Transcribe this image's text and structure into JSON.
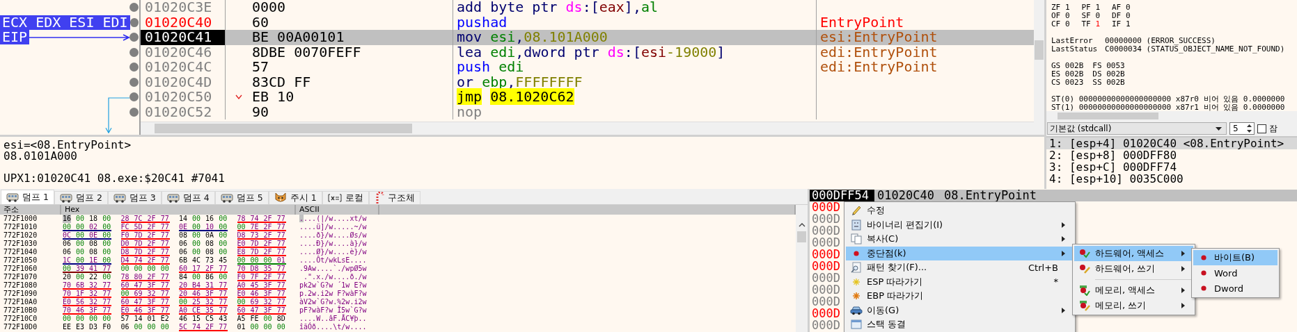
{
  "disasm": {
    "rows": [
      {
        "address": "01020C3E",
        "labeled": false,
        "selected": false,
        "jump": false,
        "bytes": "0000",
        "tokens": [
          {
            "kind": "op",
            "text": "add byte ptr "
          },
          {
            "kind": "seg",
            "text": "ds"
          },
          {
            "kind": "op",
            "text": ":["
          },
          {
            "kind": "mem",
            "text": "eax"
          },
          {
            "kind": "op",
            "text": "],"
          },
          {
            "kind": "reg",
            "text": "al"
          }
        ]
      },
      {
        "address": "01020C40",
        "labeled": true,
        "selected": false,
        "jump": false,
        "tag": {
          "text": "ECX EDX ESI EDI",
          "arrow": false
        },
        "bytes": "60",
        "tokens": [
          {
            "kind": "push",
            "text": "pushad"
          }
        ],
        "comment": {
          "kind": "label",
          "text": "EntryPoint"
        }
      },
      {
        "address": "01020C41",
        "labeled": false,
        "selected": true,
        "jump": false,
        "tag": {
          "text": "EIP",
          "arrow": true
        },
        "bytes": "BE 00A00101",
        "tokens": [
          {
            "kind": "op",
            "text": "mov "
          },
          {
            "kind": "reg",
            "text": "esi"
          },
          {
            "kind": "op",
            "text": ","
          },
          {
            "kind": "num",
            "text": "08.101A000"
          }
        ],
        "comment": {
          "kind": "auto",
          "text": "esi:EntryPoint"
        }
      },
      {
        "address": "01020C46",
        "labeled": false,
        "selected": false,
        "jump": false,
        "bytes": "8DBE 0070FEFF",
        "tokens": [
          {
            "kind": "op",
            "text": "lea "
          },
          {
            "kind": "reg",
            "text": "edi"
          },
          {
            "kind": "op",
            "text": ",dword ptr "
          },
          {
            "kind": "seg",
            "text": "ds"
          },
          {
            "kind": "op",
            "text": ":["
          },
          {
            "kind": "mem",
            "text": "esi"
          },
          {
            "kind": "num",
            "text": "-19000"
          },
          {
            "kind": "op",
            "text": "]"
          }
        ],
        "comment": {
          "kind": "auto",
          "text": "edi:EntryPoint"
        }
      },
      {
        "address": "01020C4C",
        "labeled": false,
        "selected": false,
        "jump": false,
        "bytes": "57",
        "tokens": [
          {
            "kind": "push",
            "text": "push "
          },
          {
            "kind": "reg",
            "text": "edi"
          }
        ],
        "comment": {
          "kind": "auto",
          "text": "edi:EntryPoint"
        }
      },
      {
        "address": "01020C4D",
        "labeled": false,
        "selected": false,
        "jump": false,
        "bytes": "83CD FF",
        "tokens": [
          {
            "kind": "op",
            "text": "or "
          },
          {
            "kind": "reg",
            "text": "ebp"
          },
          {
            "kind": "op",
            "text": ","
          },
          {
            "kind": "num",
            "text": "FFFFFFFF"
          }
        ]
      },
      {
        "address": "01020C50",
        "labeled": false,
        "selected": false,
        "jump": true,
        "bytes": "EB 10",
        "tokens": [
          {
            "kind": "jmp",
            "text": "jmp"
          },
          {
            "kind": "jmp",
            "text": "08.1020C62"
          }
        ]
      },
      {
        "address": "01020C52",
        "labeled": false,
        "selected": false,
        "jump": false,
        "bytes": "90",
        "tokens": [
          {
            "kind": "nop",
            "text": "nop"
          }
        ]
      }
    ]
  },
  "info": {
    "lines": [
      "esi=<08.EntryPoint>",
      "08.0101A000"
    ],
    "location": "UPX1:01020C41 08.exe:$20C41 #7041"
  },
  "registers": {
    "flag_rows": [
      [
        {
          "name": "ZF",
          "value": "1",
          "changed": false
        },
        {
          "name": "PF",
          "value": "1",
          "changed": false
        },
        {
          "name": "AF",
          "value": "0",
          "changed": false
        }
      ],
      [
        {
          "name": "OF",
          "value": "0",
          "changed": false
        },
        {
          "name": "SF",
          "value": "0",
          "changed": false
        },
        {
          "name": "DF",
          "value": "0",
          "changed": false
        }
      ],
      [
        {
          "name": "CF",
          "value": "0",
          "changed": false
        },
        {
          "name": "TF",
          "value": "1",
          "changed": true
        },
        {
          "name": "IF",
          "value": "1",
          "changed": false
        }
      ]
    ],
    "errors": [
      {
        "name": "LastError",
        "value": "00000000 (ERROR_SUCCESS)"
      },
      {
        "name": "LastStatus",
        "value": "C0000034 (STATUS_OBJECT_NAME_NOT_FOUND)"
      }
    ],
    "segment_rows": [
      [
        {
          "name": "GS",
          "value": "002B"
        },
        {
          "name": "FS",
          "value": "0053"
        }
      ],
      [
        {
          "name": "ES",
          "value": "002B"
        },
        {
          "name": "DS",
          "value": "002B"
        }
      ],
      [
        {
          "name": "CS",
          "value": "0023"
        },
        {
          "name": "SS",
          "value": "002B"
        }
      ]
    ],
    "fpu": [
      "ST(0) 00000000000000000000 x87r0 비어 있음 0.0000000",
      "ST(1) 00000000000000000000 x87r1 비어 있음 0.0000000"
    ]
  },
  "arguments": {
    "convention": "기본값 (stdcall)",
    "count": "5",
    "lock": {
      "label": "잠",
      "checked": false
    },
    "rows": [
      {
        "text": "1: [esp+4] 01020C40 <08.EntryPoint>",
        "selected": true
      },
      {
        "text": "2: [esp+8] 000DFF80",
        "selected": false
      },
      {
        "text": "3: [esp+C] 000DFF74",
        "selected": false
      },
      {
        "text": "4: [esp+10] 0035C000",
        "selected": false
      }
    ]
  },
  "tabs": [
    {
      "label": "덤프 1",
      "kind": "dump",
      "selected": true
    },
    {
      "label": "덤프 2",
      "kind": "dump",
      "selected": false
    },
    {
      "label": "덤프 3",
      "kind": "dump",
      "selected": false
    },
    {
      "label": "덤프 4",
      "kind": "dump",
      "selected": false
    },
    {
      "label": "덤프 5",
      "kind": "dump",
      "selected": false
    },
    {
      "label": "주시 1",
      "kind": "watch",
      "selected": false
    },
    {
      "label": "로컬",
      "kind": "locals",
      "selected": false
    },
    {
      "label": "구조체",
      "kind": "struct",
      "selected": false
    }
  ],
  "dump": {
    "columns": [
      "주소",
      "Hex",
      "ASCII"
    ],
    "rows": [
      {
        "address": "772F1000",
        "cursor": true,
        "groups": [
          {
            "bytes": "16 00 18 00"
          },
          {
            "bytes": "28 7C 2F 77",
            "color": "#ff0000"
          },
          {
            "bytes": "14 00 16 00"
          },
          {
            "bytes": "78 74 2F 77",
            "color": "#ff0000"
          }
        ],
        "ascii": "....(|/w....xt/w"
      },
      {
        "address": "772F1010",
        "cursor": false,
        "groups": [
          {
            "bytes": "00 00 02 00",
            "color": "#000080"
          },
          {
            "bytes": "FC 5D 2F 77",
            "color": "#ff0000"
          },
          {
            "bytes": "0E 00 10 00",
            "color": "#000080"
          },
          {
            "bytes": "00 7E 2F 77",
            "color": "#ff0000"
          }
        ],
        "ascii": "....ü]/w.....~/w"
      },
      {
        "address": "772F1020",
        "cursor": false,
        "groups": [
          {
            "bytes": "0C 00 0E 00",
            "color": "#000080"
          },
          {
            "bytes": "F0 7D 2F 77",
            "color": "#ff0000"
          },
          {
            "bytes": "08 00 0A 00"
          },
          {
            "bytes": "D8 73 2F 77",
            "color": "#ff0000"
          }
        ],
        "ascii": "....ð}/w....Øs/w"
      },
      {
        "address": "772F1030",
        "cursor": false,
        "groups": [
          {
            "bytes": "06 00 08 00"
          },
          {
            "bytes": "D0 7D 2F 77",
            "color": "#ff0000"
          },
          {
            "bytes": "06 00 08 00"
          },
          {
            "bytes": "E0 7D 2F 77",
            "color": "#ff0000"
          }
        ],
        "ascii": "....Ð}/w....à}/w"
      },
      {
        "address": "772F1040",
        "cursor": false,
        "groups": [
          {
            "bytes": "06 00 08 00"
          },
          {
            "bytes": "D8 7D 2F 77",
            "color": "#ff0000"
          },
          {
            "bytes": "06 00 08 00"
          },
          {
            "bytes": "E8 7D 2F 77",
            "color": "#ff0000"
          }
        ],
        "ascii": "....Ø}/w....è}/w"
      },
      {
        "address": "772F1050",
        "cursor": false,
        "groups": [
          {
            "bytes": "1C 00 1E 00",
            "color": "#000080"
          },
          {
            "bytes": "D4 74 2F 77",
            "color": "#ff0000"
          },
          {
            "bytes": "6B 4C 73 45"
          },
          {
            "bytes": "00 00 00 01",
            "color": "#008000"
          }
        ],
        "ascii": "....Ôt/wkLsE...."
      },
      {
        "address": "772F1060",
        "cursor": false,
        "groups": [
          {
            "bytes": "00 39 41 77",
            "color": "#800000"
          },
          {
            "bytes": "00 00 00 00"
          },
          {
            "bytes": "60 17 2F 77",
            "color": "#ff0000"
          },
          {
            "bytes": "70 D8 35 77",
            "color": "#ff0000"
          }
        ],
        "ascii": ".9Aw....`./wpØ5w"
      },
      {
        "address": "772F1070",
        "cursor": false,
        "groups": [
          {
            "bytes": "20 00 22 00"
          },
          {
            "bytes": "78 80 2F 77",
            "color": "#ff0000"
          },
          {
            "bytes": "84 00 86 00"
          },
          {
            "bytes": "F0 7F 2F 77",
            "color": "#ff0000"
          }
        ],
        "ascii": " .\".x./w....ð./w"
      },
      {
        "address": "772F1080",
        "cursor": false,
        "groups": [
          {
            "bytes": "70 6B 32 77",
            "color": "#ff0000"
          },
          {
            "bytes": "60 47 3F 77",
            "color": "#ff0000"
          },
          {
            "bytes": "20 B4 31 77",
            "color": "#ff0000"
          },
          {
            "bytes": "A0 45 3F 77",
            "color": "#ff0000"
          }
        ],
        "ascii": "pk2w`G?w ´1w E?w"
      },
      {
        "address": "772F1090",
        "cursor": false,
        "groups": [
          {
            "bytes": "70 1F 32 77",
            "color": "#ff0000"
          },
          {
            "bytes": "00 69 32 77",
            "color": "#ff0000"
          },
          {
            "bytes": "20 46 3F 77",
            "color": "#ff0000"
          },
          {
            "bytes": "E0 46 3F 77",
            "color": "#ff0000"
          }
        ],
        "ascii": "p.2w.i2w F?wàF?w"
      },
      {
        "address": "772F10A0",
        "cursor": false,
        "groups": [
          {
            "bytes": "E0 56 32 77",
            "color": "#ff0000"
          },
          {
            "bytes": "60 47 3F 77",
            "color": "#ff0000"
          },
          {
            "bytes": "00 25 32 77",
            "color": "#ff0000"
          },
          {
            "bytes": "00 69 32 77",
            "color": "#ff0000"
          }
        ],
        "ascii": "àV2w`G?w.%2w.i2w"
      },
      {
        "address": "772F10B0",
        "cursor": false,
        "groups": [
          {
            "bytes": "70 46 3F 77",
            "color": "#ff0000"
          },
          {
            "bytes": "E0 46 3F 77",
            "color": "#ff0000"
          },
          {
            "bytes": "A0 CE 35 77",
            "color": "#ff0000"
          },
          {
            "bytes": "60 47 3F 77",
            "color": "#ff0000"
          }
        ],
        "ascii": "pF?wàF?w Î5w`G?w"
      },
      {
        "address": "772F10C0",
        "cursor": false,
        "groups": [
          {
            "bytes": "00 00 00 00"
          },
          {
            "bytes": "57 14 01 E2"
          },
          {
            "bytes": "46 15 C5 43"
          },
          {
            "bytes": "A5 FE 00 8D"
          }
        ],
        "ascii": "....W..âF.ÅC¥þ.."
      },
      {
        "address": "772F10D0",
        "cursor": false,
        "groups": [
          {
            "bytes": "EE E3 D3 F0"
          },
          {
            "bytes": "06 00 00 00"
          },
          {
            "bytes": "5C 74 2F 77",
            "color": "#ff0000"
          },
          {
            "bytes": "01 00 00 00"
          }
        ],
        "ascii": "îãÓð....\\t/w...."
      }
    ]
  },
  "stack": {
    "top": {
      "address": "000DFF54",
      "value": "01020C40",
      "comment": "08.EntryPoint"
    },
    "rows": [
      {
        "address": "000D",
        "marked": true
      },
      {
        "address": "000D",
        "marked": false
      },
      {
        "address": "000D",
        "marked": false
      },
      {
        "address": "000D",
        "marked": false
      },
      {
        "address": "000D",
        "marked": true
      },
      {
        "address": "000D",
        "marked": true
      },
      {
        "address": "000D",
        "marked": false
      },
      {
        "address": "000D",
        "marked": false
      },
      {
        "address": "000D",
        "marked": false
      },
      {
        "address": "000D",
        "marked": true
      },
      {
        "address": "000D",
        "marked": false
      }
    ]
  },
  "context_menu": {
    "items": [
      {
        "label": "수정",
        "kind": "edit",
        "submenu": false,
        "selected": false
      },
      {
        "label": "바이너리 편집기(I)",
        "kind": "binary",
        "submenu": true,
        "selected": false
      },
      {
        "label": "복사(C)",
        "kind": "copy",
        "submenu": true,
        "selected": false
      },
      {
        "label": "중단점(k)",
        "kind": "breakpoint",
        "submenu": true,
        "selected": true
      },
      {
        "label": "패턴 찾기(F)...",
        "kind": "find",
        "submenu": false,
        "selected": false,
        "shortcut": "Ctrl+B"
      },
      {
        "label": "ESP 따라가기",
        "kind": "follow-esp",
        "submenu": false,
        "selected": false,
        "shortcut": "*"
      },
      {
        "label": "EBP 따라가기",
        "kind": "follow-ebp",
        "submenu": false,
        "selected": false
      },
      {
        "label": "이동(G)",
        "kind": "goto",
        "submenu": true,
        "selected": false
      },
      {
        "label": "스택 동결",
        "kind": "freeze",
        "submenu": false,
        "selected": false
      }
    ],
    "submenu": [
      {
        "label": "하드웨어, 액세스",
        "kind": "hw-access",
        "selected": true,
        "separator_before": false
      },
      {
        "label": "하드웨어, 쓰기",
        "kind": "hw-write",
        "selected": false,
        "separator_before": false
      },
      {
        "label": "메모리, 액세스",
        "kind": "mem-access",
        "selected": false,
        "separator_before": true
      },
      {
        "label": "메모리, 쓰기",
        "kind": "mem-write",
        "selected": false,
        "separator_before": false
      }
    ],
    "sizes": [
      {
        "label": "바이트(B)",
        "selected": true
      },
      {
        "label": "Word",
        "selected": false
      },
      {
        "label": "Dword",
        "selected": false
      }
    ]
  }
}
